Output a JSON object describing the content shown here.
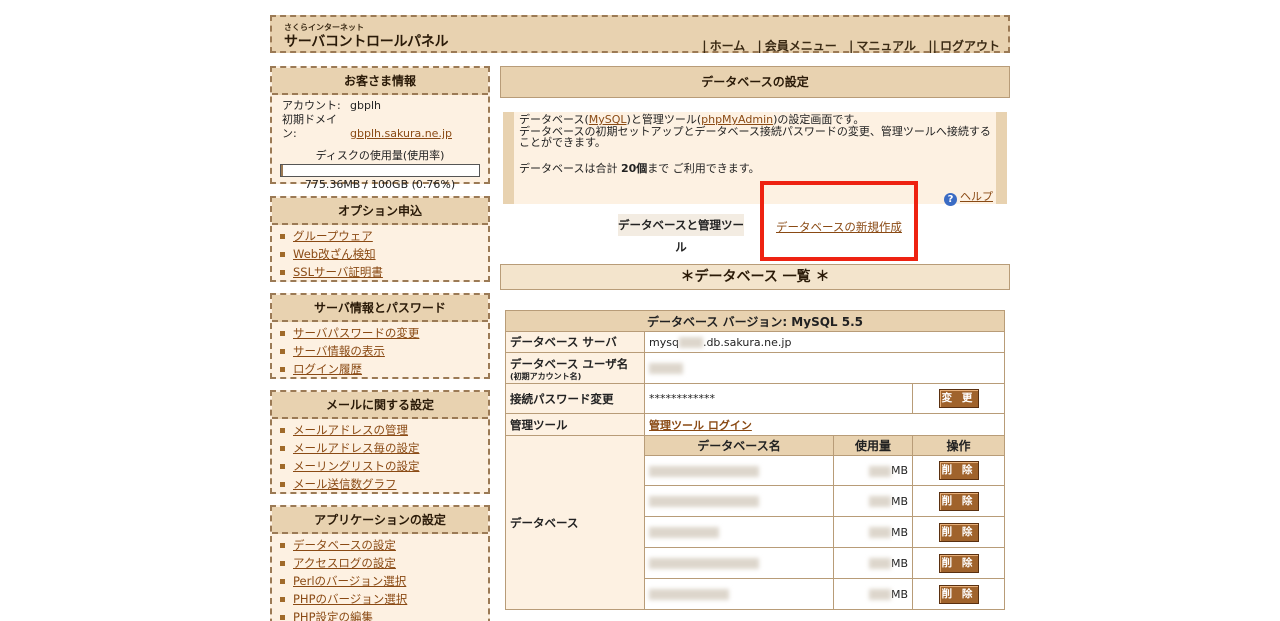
{
  "header": {
    "logo_small": "さくらインターネット",
    "logo_big": "サーバコントロールパネル",
    "nav": [
      "ホーム",
      "会員メニュー",
      "マニュアル",
      "ログアウト"
    ]
  },
  "sidebar": {
    "customer": {
      "title": "お客さま情報",
      "account_label": "アカウント:",
      "account_value": "gbplh",
      "domain_label": "初期ドメイン:",
      "domain_value": "gbplh.sakura.ne.jp",
      "disk_label": "ディスクの使用量(使用率)",
      "disk_value": "775.36MB / 100GB (0.76%)",
      "disk_fraction": 0.0076
    },
    "options": {
      "title": "オプション申込",
      "items": [
        "グループウェア",
        "Web改ざん検知",
        "SSLサーバ証明書"
      ]
    },
    "server": {
      "title": "サーバ情報とパスワード",
      "items": [
        "サーバパスワードの変更",
        "サーバ情報の表示",
        "ログイン履歴"
      ]
    },
    "mail": {
      "title": "メールに関する設定",
      "items": [
        "メールアドレスの管理",
        "メールアドレス毎の設定",
        "メーリングリストの設定",
        "メール送信数グラフ"
      ]
    },
    "apps": {
      "title": "アプリケーションの設定",
      "items": [
        "データベースの設定",
        "アクセスログの設定",
        "Perlのバージョン選択",
        "PHPのバージョン選択",
        "PHP設定の編集"
      ]
    }
  },
  "main": {
    "title": "データベースの設定",
    "desc_a": "データベース(",
    "desc_mysql": "MySQL",
    "desc_b": ")と管理ツール(",
    "desc_pma": "phpMyAdmin",
    "desc_c": ")の設定画面です。",
    "desc_line2": "データベースの初期セットアップとデータベース接続パスワードの変更、管理ツールへ接続することができます。",
    "total_prefix": "データベースは合計 ",
    "total_count": "20個",
    "total_suffix": "まで ご利用できます。",
    "help": "ヘルプ",
    "tab_db": "データベースと管理ツール",
    "tab_new": "データベースの新規作成",
    "list_title": "＊データベース 一覧 ＊"
  },
  "table": {
    "version": "データベース バージョン: MySQL 5.5",
    "server_label": "データベース サーバ",
    "server_value_prefix": "mysq",
    "server_value_suffix": ".db.sakura.ne.jp",
    "user_label": "データベース ユーザ名",
    "user_sub": "(初期アカウント名)",
    "password_label": "接続パスワード変更",
    "password_value": "************",
    "change_button": "変 更",
    "tool_label": "管理ツール",
    "tool_link": "管理ツール ログイン",
    "db_label": "データベース",
    "col_name": "データベース名",
    "col_usage": "使用量",
    "col_op": "操作",
    "rows": [
      {
        "usage_unit": "MB",
        "button": "削 除"
      },
      {
        "usage_unit": "MB",
        "button": "削 除"
      },
      {
        "usage_unit": "MB",
        "button": "削 除"
      },
      {
        "usage_unit": "MB",
        "button": "削 除"
      },
      {
        "usage_unit": "MB",
        "button": "削 除"
      }
    ]
  }
}
